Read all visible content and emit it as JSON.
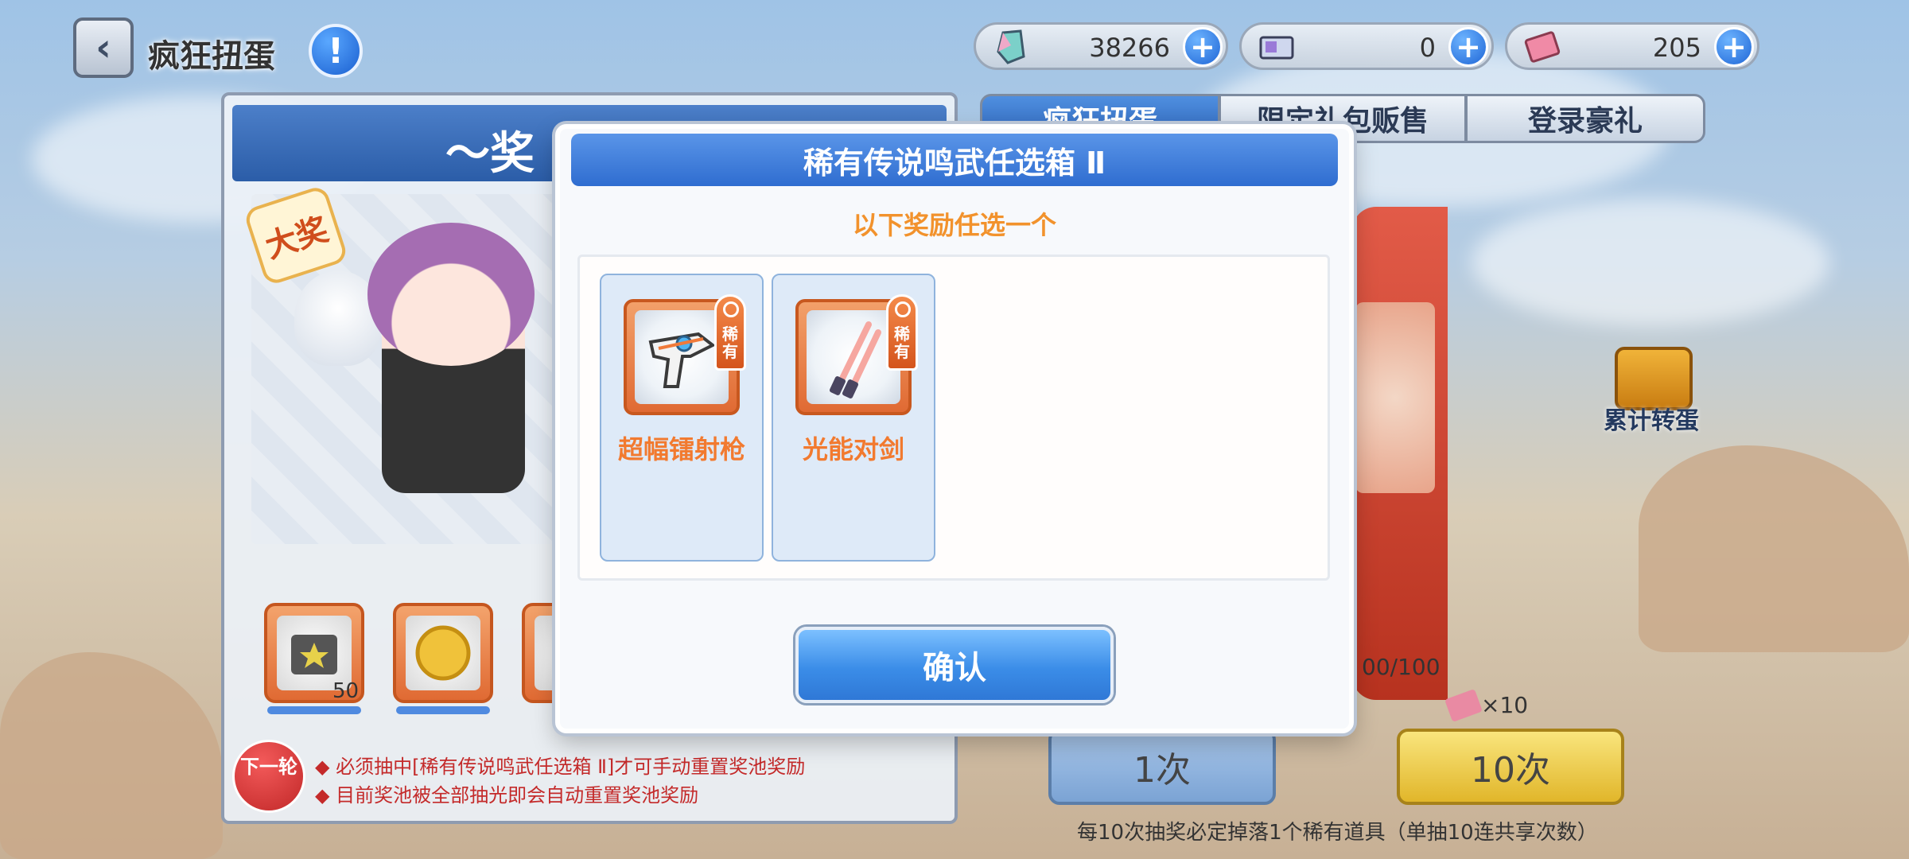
{
  "header": {
    "title": "疯狂扭蛋",
    "info_label": "!"
  },
  "currencies": [
    {
      "icon": "crystal-icon",
      "value": "38266"
    },
    {
      "icon": "ticket-icon",
      "value": "0"
    },
    {
      "icon": "pink-ticket-icon",
      "value": "205"
    }
  ],
  "tabs": [
    {
      "label": "疯狂扭蛋",
      "active": true
    },
    {
      "label": "限定礼包贩售",
      "active": false
    },
    {
      "label": "登录豪礼",
      "active": false
    }
  ],
  "prize_panel": {
    "header": "～奖",
    "big_prize_badge": "大奖",
    "slot_count": "50",
    "next_round": "下一轮",
    "rules": [
      "◆ 必须抽中[稀有传说鸣武任选箱 Ⅱ]才可手动重置奖池奖励",
      "◆ 目前奖池被全部抽光即会自动重置奖池奖励"
    ]
  },
  "right_panel": {
    "cumulative_label": "累计转蛋",
    "progress": "00/100",
    "multiplier": "×10",
    "draw_one": "1次",
    "draw_ten": "10次",
    "note": "每10次抽奖必定掉落1个稀有道具（单抽10连共享次数）"
  },
  "modal": {
    "title": "稀有传说鸣武任选箱 Ⅱ",
    "subtitle": "以下奖励任选一个",
    "rarity_label": "稀有",
    "items": [
      {
        "name": "超幅镭射枪",
        "icon": "laser-gun-icon"
      },
      {
        "name": "光能对剑",
        "icon": "dual-light-sword-icon"
      }
    ],
    "confirm": "确认"
  },
  "colors": {
    "modal_header": "#2f6dd0",
    "subtitle": "#f2922c",
    "item_name": "#f27a2f",
    "confirm": "#3b8de8"
  }
}
